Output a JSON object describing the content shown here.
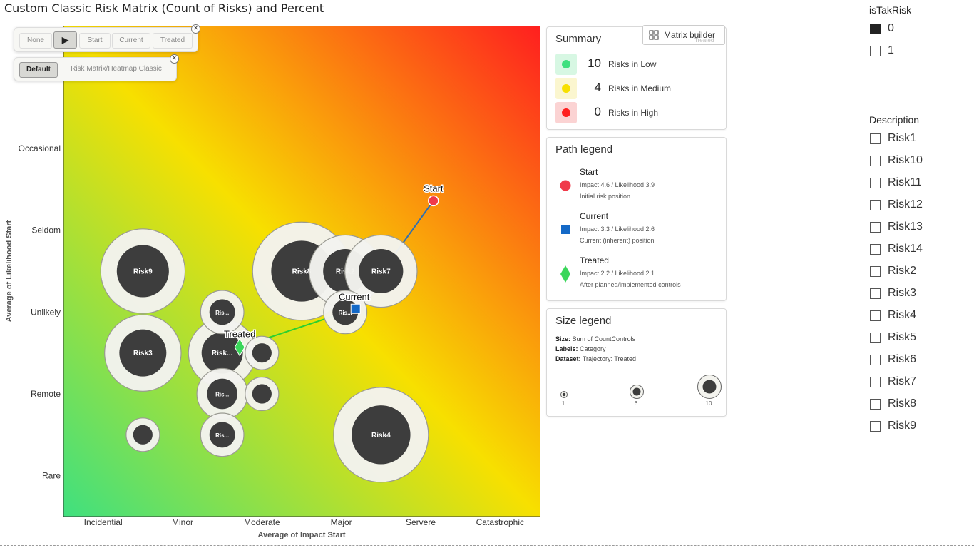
{
  "title": "Custom Classic Risk Matrix (Count of Risks) and Percent",
  "controls": {
    "play_buttons": [
      "None",
      "▶",
      "Start",
      "Current",
      "Treated"
    ],
    "view_buttons": [
      "Default",
      "Risk Matrix/Heatmap Classic"
    ],
    "close_icon": "✕"
  },
  "matrix_builder": {
    "label": "Matrix builder",
    "ghost": "Treated"
  },
  "chart_data": {
    "type": "scatter",
    "xlabel": "Average of Impact Start",
    "ylabel": "Average of Likelihood Start",
    "x_categories": [
      "Incidential",
      "Minor",
      "Moderate",
      "Major",
      "Servere",
      "Catastrophic"
    ],
    "y_categories": [
      "Rare",
      "Remote",
      "Unlikely",
      "Seldom",
      "Occasional"
    ],
    "xlim": [
      0.5,
      6.5
    ],
    "ylim": [
      0.5,
      6.5
    ],
    "colors": {
      "low": "#3fe07f",
      "medium": "#f7e000",
      "high": "#ff1f1f"
    },
    "bubbles": [
      {
        "label": "Risk9",
        "x": 1.5,
        "y": 3.5,
        "size": 10
      },
      {
        "label": "Risk3",
        "x": 1.5,
        "y": 2.5,
        "size": 8
      },
      {
        "label": "Risk...",
        "x": 2.5,
        "y": 2.5,
        "size": 6
      },
      {
        "label": "Risk8",
        "x": 3.5,
        "y": 3.5,
        "size": 14
      },
      {
        "label": "Risk2",
        "x": 4.05,
        "y": 3.5,
        "size": 7
      },
      {
        "label": "Risk7",
        "x": 4.5,
        "y": 3.5,
        "size": 7
      },
      {
        "label": "Risk4",
        "x": 4.5,
        "y": 1.5,
        "size": 13
      },
      {
        "label": "Ris...",
        "x": 2.5,
        "y": 3.0,
        "size": 2
      },
      {
        "label": "Ris...",
        "x": 4.05,
        "y": 3.0,
        "size": 2
      },
      {
        "label": "Ris...",
        "x": 2.5,
        "y": 2.0,
        "size": 3
      },
      {
        "label": "Ris...",
        "x": 2.5,
        "y": 1.5,
        "size": 2
      },
      {
        "label": "",
        "x": 1.5,
        "y": 1.5,
        "size": 1
      },
      {
        "label": "",
        "x": 3.0,
        "y": 2.5,
        "size": 1
      },
      {
        "label": "",
        "x": 3.0,
        "y": 2.0,
        "size": 1
      }
    ],
    "path": {
      "start": {
        "label": "Start",
        "x": 5.16,
        "y": 4.36
      },
      "current": {
        "label": "Current",
        "x": 4.18,
        "y": 3.04
      },
      "treated": {
        "label": "Treated",
        "x": 2.72,
        "y": 2.57
      }
    }
  },
  "summary": {
    "title": "Summary",
    "rows": [
      {
        "count": "10",
        "text": "Risks in Low",
        "color": "#3fe07f",
        "bg": "#d7f7e3"
      },
      {
        "count": "4",
        "text": "Risks in Medium",
        "color": "#f7e000",
        "bg": "#fbf6cf"
      },
      {
        "count": "0",
        "text": "Risks in High",
        "color": "#ff1f1f",
        "bg": "#fbd3d3"
      }
    ]
  },
  "path_legend": {
    "title": "Path legend",
    "items": [
      {
        "name": "Start",
        "line1": "Impact 4.6 / Likelihood 3.9",
        "line2": "Initial risk position",
        "icon": "circle-icon",
        "color": "#f03a4a"
      },
      {
        "name": "Current",
        "line1": "Impact 3.3 / Likelihood 2.6",
        "line2": "Current (inherent) position",
        "icon": "square-icon",
        "color": "#1469c7"
      },
      {
        "name": "Treated",
        "line1": "Impact 2.2 / Likelihood 2.1",
        "line2": "After planned/implemented controls",
        "icon": "diamond-icon",
        "color": "#3ad65a"
      }
    ]
  },
  "size_legend": {
    "title": "Size legend",
    "lines": [
      {
        "key": "Size:",
        "value": "Sum of CountControls"
      },
      {
        "key": "Labels:",
        "value": "Category"
      },
      {
        "key": "Dataset:",
        "value": "Trajectory: Treated"
      }
    ],
    "samples": [
      "1",
      "6",
      "10"
    ]
  },
  "slicer_istakrisk": {
    "title": "isTakRisk",
    "items": [
      {
        "label": "0",
        "checked": true
      },
      {
        "label": "1",
        "checked": false
      }
    ]
  },
  "slicer_description": {
    "title": "Description",
    "items": [
      "Risk1",
      "Risk10",
      "Risk11",
      "Risk12",
      "Risk13",
      "Risk14",
      "Risk2",
      "Risk3",
      "Risk4",
      "Risk5",
      "Risk6",
      "Risk7",
      "Risk8",
      "Risk9"
    ]
  }
}
